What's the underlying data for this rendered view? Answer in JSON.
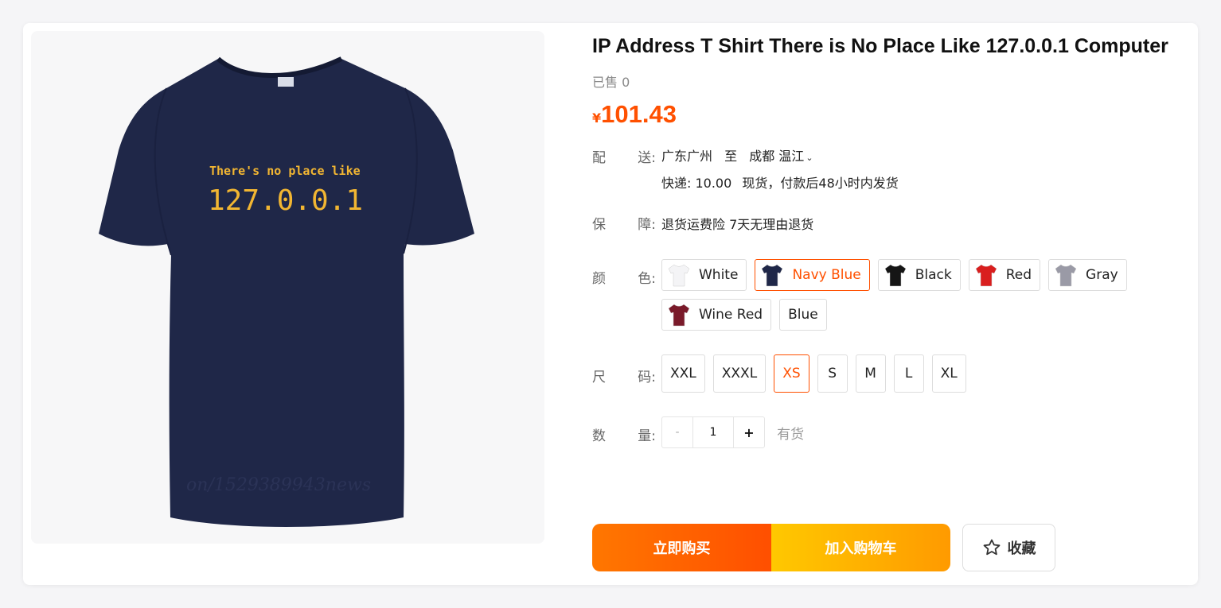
{
  "product": {
    "title": "IP Address T Shirt There is No Place Like 127.0.0.1 Computer",
    "sold": "已售 0",
    "price_currency": "¥",
    "price_value": "101.43",
    "image_text_line1": "There's no place like",
    "image_text_line2": "127.0.0.1",
    "image_watermark": "on/1529389943news"
  },
  "shipping": {
    "label_a": "配",
    "label_b": "送:",
    "from": "广东广州",
    "to_word": "至",
    "to": "成都 温江",
    "express": "快递: 10.00",
    "stock_note": "现货，付款后48小时内发货"
  },
  "warranty": {
    "label_a": "保",
    "label_b": "障:",
    "text": "退货运费险 7天无理由退货"
  },
  "colors": {
    "label_a": "颜",
    "label_b": "色:",
    "options": [
      {
        "name": "White",
        "swatch": "#f4f4f6",
        "selected": false
      },
      {
        "name": "Navy Blue",
        "swatch": "#1f2748",
        "selected": true
      },
      {
        "name": "Black",
        "swatch": "#151515",
        "selected": false
      },
      {
        "name": "Red",
        "swatch": "#d91e1e",
        "selected": false
      },
      {
        "name": "Gray",
        "swatch": "#9a9aa6",
        "selected": false
      },
      {
        "name": "Wine Red",
        "swatch": "#7a1a2a",
        "selected": false
      },
      {
        "name": "Blue",
        "swatch": "",
        "selected": false
      }
    ]
  },
  "sizes": {
    "label_a": "尺",
    "label_b": "码:",
    "options": [
      "XXL",
      "XXXL",
      "XS",
      "S",
      "M",
      "L",
      "XL"
    ],
    "selected": "XS"
  },
  "quantity": {
    "label_a": "数",
    "label_b": "量:",
    "minus": "-",
    "value": "1",
    "plus": "+",
    "stock": "有货"
  },
  "actions": {
    "buy_now": "立即购买",
    "add_to_cart": "加入购物车",
    "favorite": "收藏"
  },
  "colors_theme": {
    "accent": "#ff5000",
    "shirt": "#1f2748",
    "print": "#f2b632"
  }
}
